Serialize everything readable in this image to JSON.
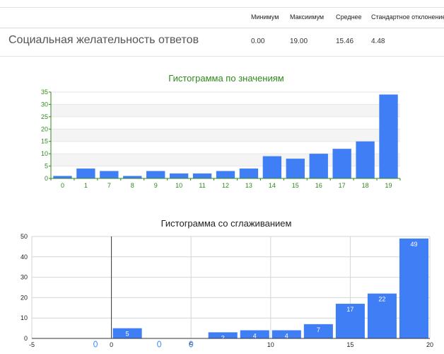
{
  "stats_table": {
    "headers": [
      "Минимум",
      "Максиимум",
      "Среднее",
      "Стандартное отклонение"
    ],
    "row_label": "Социальная желательность ответов",
    "values": [
      "0.00",
      "19.00",
      "15.46",
      "4.48"
    ]
  },
  "chart_data": [
    {
      "type": "bar",
      "title": "Гистограмма по значениям",
      "categories": [
        "0",
        "1",
        "7",
        "8",
        "9",
        "10",
        "11",
        "12",
        "13",
        "14",
        "15",
        "16",
        "17",
        "18",
        "19"
      ],
      "values": [
        1,
        4,
        3,
        1,
        3,
        2,
        2,
        3,
        4,
        9,
        8,
        10,
        12,
        15,
        34
      ],
      "ylim": [
        0,
        35
      ],
      "yticks": [
        0,
        5,
        10,
        15,
        20,
        25,
        30,
        35
      ],
      "bar_color": "#3f7ef5",
      "title_color": "#2f8a1b",
      "grid": true
    },
    {
      "type": "bar",
      "title": "Гистограмма со сглаживанием",
      "bins": [
        {
          "start": 0,
          "end": 2,
          "value": 5,
          "label": "5"
        },
        {
          "start": 6,
          "end": 8,
          "value": 3,
          "label": "3"
        },
        {
          "start": 8,
          "end": 10,
          "value": 4,
          "label": "4"
        },
        {
          "start": 10,
          "end": 12,
          "value": 4,
          "label": "4"
        },
        {
          "start": 12,
          "end": 14,
          "value": 7,
          "label": "7"
        },
        {
          "start": 14,
          "end": 16,
          "value": 17,
          "label": "17"
        },
        {
          "start": 16,
          "end": 18,
          "value": 22,
          "label": "22"
        },
        {
          "start": 18,
          "end": 20,
          "value": 49,
          "label": "49"
        }
      ],
      "xlim": [
        -5,
        20
      ],
      "xticks": [
        -5,
        0,
        5,
        10,
        15,
        20
      ],
      "ylim": [
        0,
        50
      ],
      "yticks": [
        0,
        10,
        20,
        30,
        40,
        50
      ],
      "markers_x": [
        -1,
        3,
        5
      ],
      "bar_color": "#3f7ef5",
      "marker_color": "#5b9bf5",
      "grid": true
    }
  ]
}
